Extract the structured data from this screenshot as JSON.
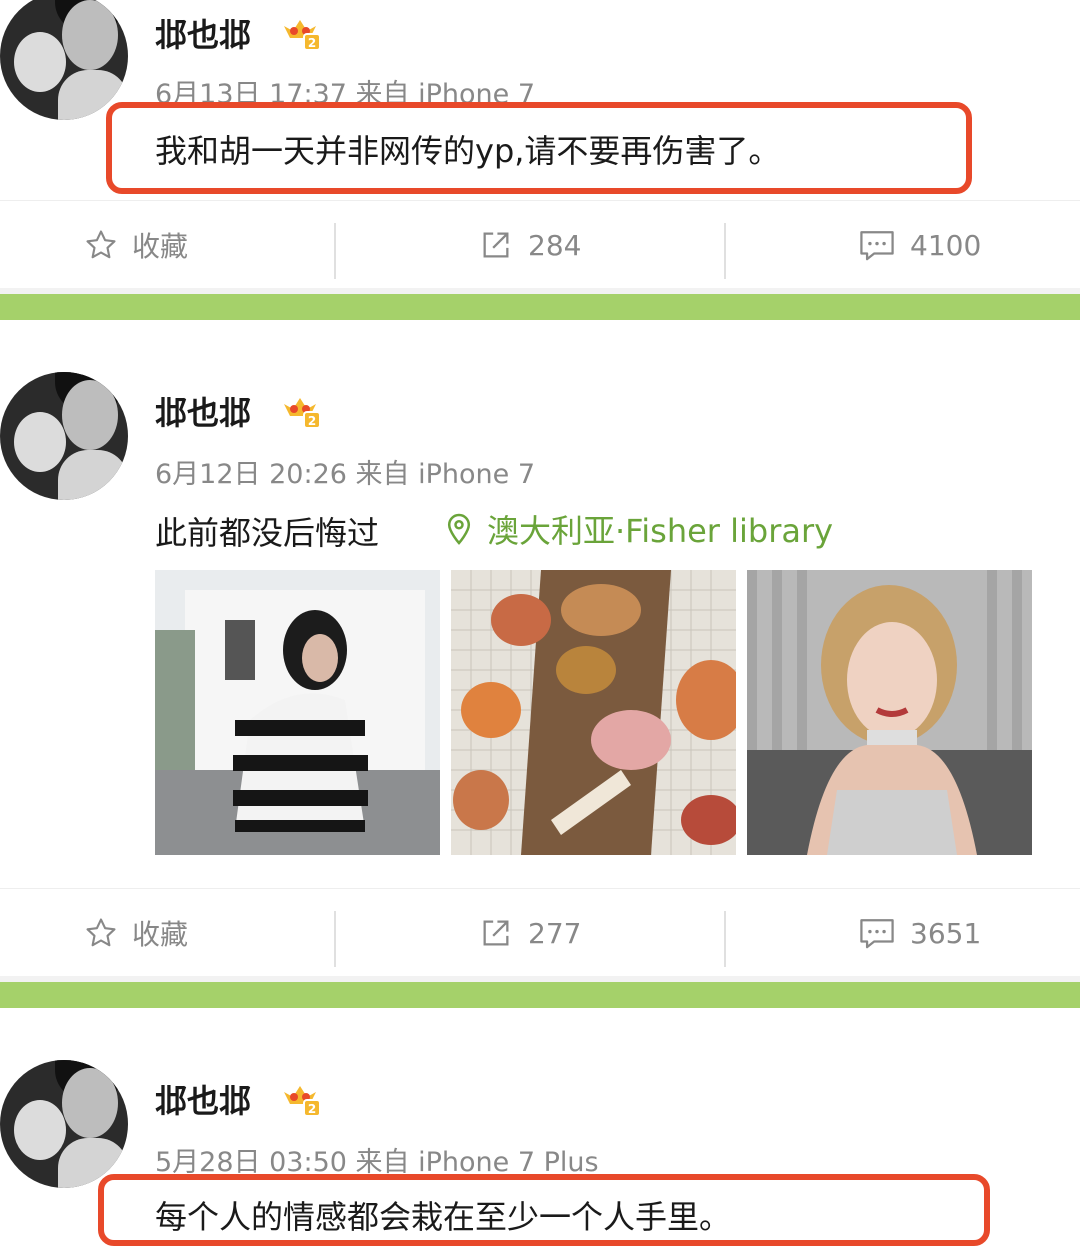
{
  "posts": [
    {
      "username": "邶也邶",
      "time": "6月13日 17:37",
      "source": "来自 iPhone 7",
      "text": "我和胡一天并非网传的yp,请不要再伤害了。",
      "actions": {
        "favorite": "收藏",
        "repost": "284",
        "comment": "4100"
      }
    },
    {
      "username": "邶也邶",
      "time": "6月12日 20:26",
      "source": "来自 iPhone 7",
      "text": "此前都没后悔过",
      "location": "澳大利亚·Fisher library",
      "actions": {
        "favorite": "收藏",
        "repost": "277",
        "comment": "3651"
      }
    },
    {
      "username": "邶也邶",
      "time": "5月28日 03:50",
      "source": "来自 iPhone 7 Plus",
      "text": "每个人的情感都会栽在至少一个人手里。"
    }
  ],
  "colors": {
    "highlight": "#e8492a",
    "separator": "#a5d16a",
    "location": "#6aa43a"
  },
  "icons": [
    "star-icon",
    "share-icon",
    "comment-icon",
    "location-pin-icon",
    "vip-crown-icon"
  ]
}
